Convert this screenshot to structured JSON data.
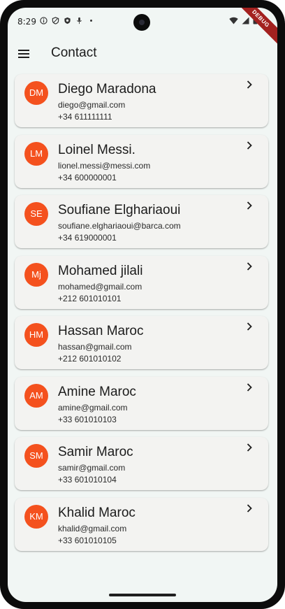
{
  "status_bar": {
    "time": "8:29",
    "left_icons": [
      "info-icon",
      "shield-icon",
      "shield-check-icon",
      "mic-off-icon",
      "dot-icon"
    ],
    "right_icons": [
      "wifi-icon",
      "signal-icon",
      "battery-icon"
    ]
  },
  "debug_banner": "DEBUG",
  "app_bar": {
    "menu_icon": "menu-icon",
    "title": "Contact"
  },
  "colors": {
    "avatar": "#f4511e",
    "background": "#f1f6f4",
    "card": "#f3f3f1"
  },
  "contacts": [
    {
      "initials": "DM",
      "name": "Diego Maradona",
      "email": "diego@gmail.com",
      "phone": "+34 611111111"
    },
    {
      "initials": "LM",
      "name": "Loinel Messi.",
      "email": "lionel.messi@messi.com",
      "phone": "+34 600000001"
    },
    {
      "initials": "SE",
      "name": "Soufiane Elghariaoui",
      "email": "soufiane.elghariaoui@barca.com",
      "phone": "+34 619000001"
    },
    {
      "initials": "Mj",
      "name": "Mohamed jilali",
      "email": "mohamed@gmail.com",
      "phone": "+212 601010101"
    },
    {
      "initials": "HM",
      "name": "Hassan Maroc",
      "email": "hassan@gmail.com",
      "phone": "+212 601010102"
    },
    {
      "initials": "AM",
      "name": "Amine Maroc",
      "email": "amine@gmail.com",
      "phone": "+33 601010103"
    },
    {
      "initials": "SM",
      "name": "Samir Maroc",
      "email": "samir@gmail.com",
      "phone": "+33 601010104"
    },
    {
      "initials": "KM",
      "name": "Khalid Maroc",
      "email": "khalid@gmail.com",
      "phone": "+33 601010105"
    }
  ]
}
